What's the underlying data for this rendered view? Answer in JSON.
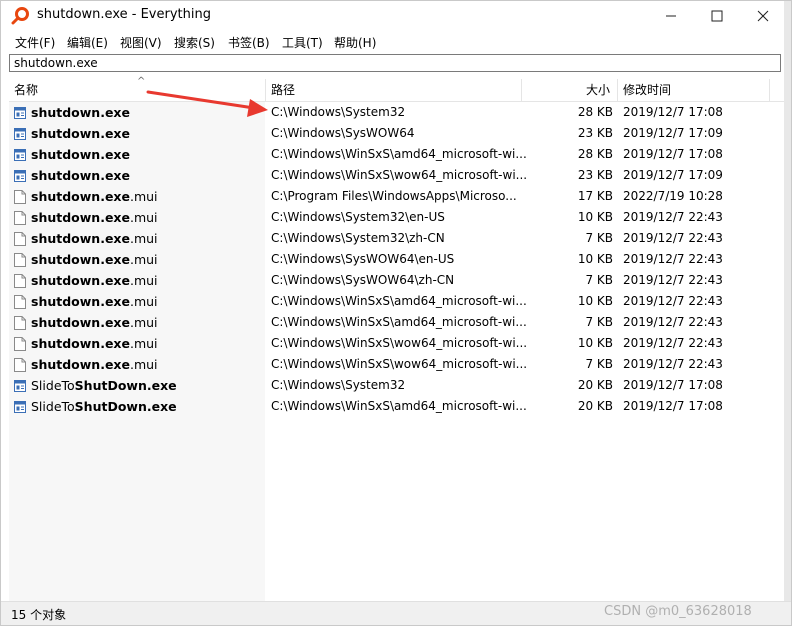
{
  "window": {
    "title": "shutdown.exe - Everything"
  },
  "menu": [
    "文件(F)",
    "编辑(E)",
    "视图(V)",
    "搜索(S)",
    "书签(B)",
    "工具(T)",
    "帮助(H)"
  ],
  "search": {
    "value": "shutdown.exe"
  },
  "columns": {
    "name": "名称",
    "path": "路径",
    "size": "大小",
    "modified": "修改时间"
  },
  "rows": [
    {
      "icon": "exe-icon",
      "bold": "shutdown.exe",
      "rest": "",
      "path": "C:\\Windows\\System32",
      "size": "28 KB",
      "modified": "2019/12/7 17:08"
    },
    {
      "icon": "exe-icon",
      "bold": "shutdown.exe",
      "rest": "",
      "path": "C:\\Windows\\SysWOW64",
      "size": "23 KB",
      "modified": "2019/12/7 17:09"
    },
    {
      "icon": "exe-icon",
      "bold": "shutdown.exe",
      "rest": "",
      "path": "C:\\Windows\\WinSxS\\amd64_microsoft-wi...",
      "size": "28 KB",
      "modified": "2019/12/7 17:08"
    },
    {
      "icon": "exe-icon",
      "bold": "shutdown.exe",
      "rest": "",
      "path": "C:\\Windows\\WinSxS\\wow64_microsoft-wi...",
      "size": "23 KB",
      "modified": "2019/12/7 17:09"
    },
    {
      "icon": "file-icon",
      "bold": "shutdown.exe",
      "rest": ".mui",
      "path": "C:\\Program Files\\WindowsApps\\Microso...",
      "size": "17 KB",
      "modified": "2022/7/19 10:28"
    },
    {
      "icon": "file-icon",
      "bold": "shutdown.exe",
      "rest": ".mui",
      "path": "C:\\Windows\\System32\\en-US",
      "size": "10 KB",
      "modified": "2019/12/7 22:43"
    },
    {
      "icon": "file-icon",
      "bold": "shutdown.exe",
      "rest": ".mui",
      "path": "C:\\Windows\\System32\\zh-CN",
      "size": "7 KB",
      "modified": "2019/12/7 22:43"
    },
    {
      "icon": "file-icon",
      "bold": "shutdown.exe",
      "rest": ".mui",
      "path": "C:\\Windows\\SysWOW64\\en-US",
      "size": "10 KB",
      "modified": "2019/12/7 22:43"
    },
    {
      "icon": "file-icon",
      "bold": "shutdown.exe",
      "rest": ".mui",
      "path": "C:\\Windows\\SysWOW64\\zh-CN",
      "size": "7 KB",
      "modified": "2019/12/7 22:43"
    },
    {
      "icon": "file-icon",
      "bold": "shutdown.exe",
      "rest": ".mui",
      "path": "C:\\Windows\\WinSxS\\amd64_microsoft-wi...",
      "size": "10 KB",
      "modified": "2019/12/7 22:43"
    },
    {
      "icon": "file-icon",
      "bold": "shutdown.exe",
      "rest": ".mui",
      "path": "C:\\Windows\\WinSxS\\amd64_microsoft-wi...",
      "size": "7 KB",
      "modified": "2019/12/7 22:43"
    },
    {
      "icon": "file-icon",
      "bold": "shutdown.exe",
      "rest": ".mui",
      "path": "C:\\Windows\\WinSxS\\wow64_microsoft-wi...",
      "size": "10 KB",
      "modified": "2019/12/7 22:43"
    },
    {
      "icon": "file-icon",
      "bold": "shutdown.exe",
      "rest": ".mui",
      "path": "C:\\Windows\\WinSxS\\wow64_microsoft-wi...",
      "size": "7 KB",
      "modified": "2019/12/7 22:43"
    },
    {
      "icon": "exe-icon",
      "pre": "SlideTo",
      "bold": "ShutDown.exe",
      "rest": "",
      "path": "C:\\Windows\\System32",
      "size": "20 KB",
      "modified": "2019/12/7 17:08"
    },
    {
      "icon": "exe-icon",
      "pre": "SlideTo",
      "bold": "ShutDown.exe",
      "rest": "",
      "path": "C:\\Windows\\WinSxS\\amd64_microsoft-wi...",
      "size": "20 KB",
      "modified": "2019/12/7 17:08"
    }
  ],
  "status": "15 个对象",
  "watermark": "CSDN @m0_63628018",
  "colors": {
    "accent": "#e8470f",
    "arrow": "#e8392f"
  }
}
